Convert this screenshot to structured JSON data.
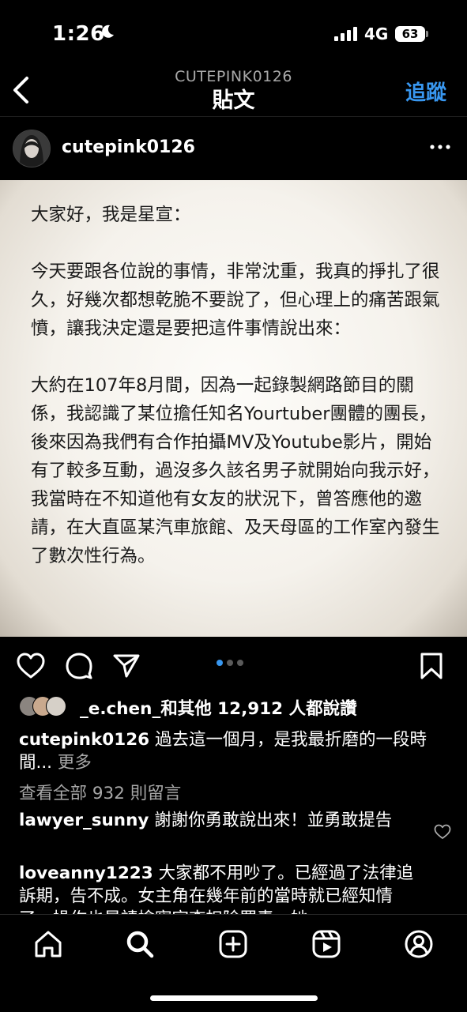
{
  "status_bar": {
    "time": "1:26",
    "network": "4G",
    "battery": "63"
  },
  "header": {
    "subtitle": "CUTEPINK0126",
    "title": "貼文",
    "follow_label": "追蹤"
  },
  "post": {
    "username": "cutepink0126",
    "image_text": [
      "大家好，我是星宣：",
      "今天要跟各位說的事情，非常沈重，我真的掙扎了很久，好幾次都想乾脆不要說了，但心理上的痛苦跟氣憤，讓我決定還是要把這件事情說出來：",
      "大約在107年8月間，因為一起錄製網路節目的關係，我認識了某位擔任知名Yourtuber團體的團長，後來因為我們有合作拍攝MV及Youtube影片，開始有了較多互動，過沒多久該名男子就開始向我示好，我當時在不知道他有女友的狀況下，曾答應他的邀請，在大直區某汽車旅館、及天母區的工作室內發生了數次性行為。"
    ],
    "carousel": {
      "count": 3,
      "active": 1
    }
  },
  "likes": {
    "text": "_e.chen_和其他 12,912 人都說讚"
  },
  "caption": {
    "username": "cutepink0126",
    "text": "過去這一個月，是我最折磨的一段時間...",
    "more_label": "更多"
  },
  "view_comments": "查看全部 932 則留言",
  "comments": [
    {
      "username": "lawyer_sunny",
      "text": "謝謝你勇敢說出來！並勇敢提告"
    },
    {
      "username": "loveanny1223",
      "text": "大家都不用吵了。已經過了法律追訴期，告不成。女主角在幾年前的當時就已經知情了，操作也是請檢察官查扣除罪責，她"
    }
  ],
  "colors": {
    "accent": "#3897f0",
    "background": "#000000",
    "muted": "#a8a8a8"
  },
  "icons": [
    "back-icon",
    "more-icon",
    "heart-icon",
    "comment-icon",
    "share-icon",
    "save-icon",
    "home-icon",
    "search-icon",
    "create-icon",
    "reels-icon",
    "profile-icon"
  ]
}
